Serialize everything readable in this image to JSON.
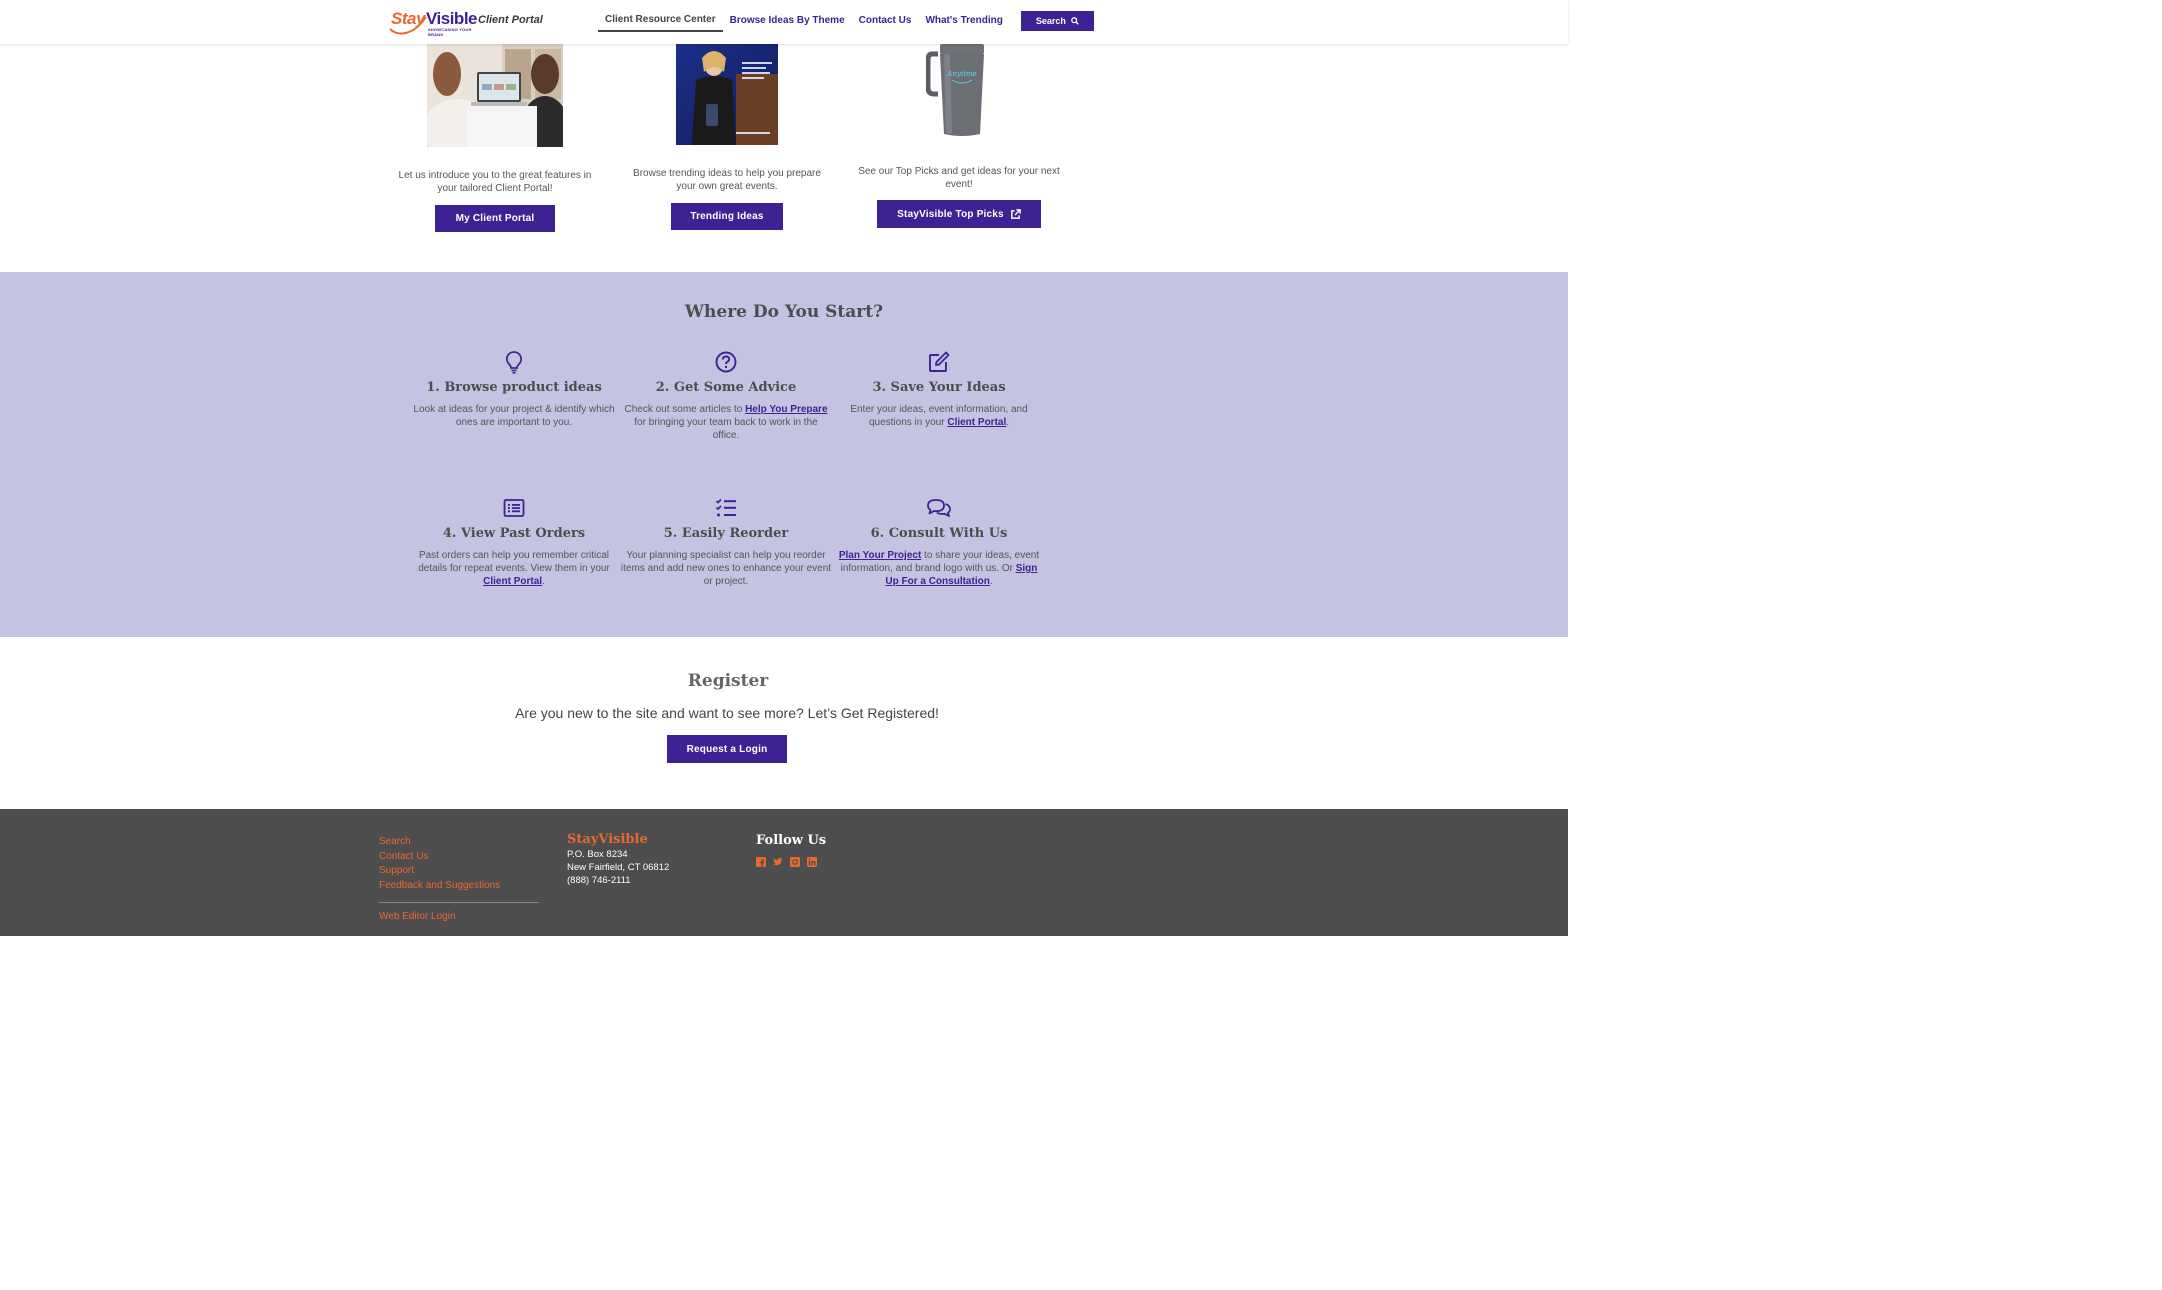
{
  "header": {
    "logo": {
      "stay": "Stay",
      "visible": "Visible",
      "tagline": "SHOWCASING YOUR BRAND",
      "portal": "Client Portal"
    },
    "nav": [
      {
        "label": "Client Resource Center",
        "active": true
      },
      {
        "label": "Browse Ideas By Theme"
      },
      {
        "label": "Contact Us"
      },
      {
        "label": "What's Trending"
      }
    ],
    "search_label": "Search"
  },
  "features": [
    {
      "image": "women-at-laptop-photo",
      "text": "Let us introduce you to the great features in your tailored Client Portal!",
      "button": "My Client Portal"
    },
    {
      "image": "trending-ideas-cover-photo",
      "text": "Browse trending ideas to help you prepare your own great events.",
      "button": "Trending Ideas"
    },
    {
      "image": "gray-tumbler-photo",
      "text": "See our Top Picks and get ideas for your next event!",
      "button": "StayVisible Top Picks"
    }
  ],
  "start": {
    "title": "Where Do You Start?",
    "steps": [
      {
        "icon": "lightbulb-icon",
        "title": "1. Browse product ideas",
        "text": "Look at ideas for your project & identify which ones are important to you."
      },
      {
        "icon": "question-circle-icon",
        "title": "2. Get Some Advice",
        "text_before": "Check out some articles to ",
        "link": "Help You Prepare",
        "text_after": " for bringing your team back to work in the office."
      },
      {
        "icon": "edit-icon",
        "title": "3. Save Your Ideas",
        "text_before": "Enter your ideas, event information, and questions in your ",
        "link": "Client Portal",
        "text_after": "."
      },
      {
        "icon": "list-alt-icon",
        "title": "4. View Past Orders",
        "text_before": "Past orders can help you remember critical details for repeat events. View them in your ",
        "link": "Client Portal",
        "text_after": "."
      },
      {
        "icon": "tasks-icon",
        "title": "5. Easily Reorder",
        "text": "Your planning specialist can help you reorder items and add new ones to enhance your event or project."
      },
      {
        "icon": "comments-icon",
        "title": "6. Consult With Us",
        "link1": "Plan Your Project",
        "text_mid": " to share your ideas, event information, and brand logo with us. Or ",
        "link2": "Sign Up For a Consultation",
        "text_after": "."
      }
    ]
  },
  "register": {
    "title": "Register",
    "text": "Are you new to the site and want to see more? Let’s Get Registered!",
    "button": "Request a Login"
  },
  "footer": {
    "links": [
      "Search",
      "Contact Us",
      "Support",
      "Feedback and Suggestions"
    ],
    "editor_login": "Web Editor Login",
    "company": "StayVisible",
    "address": [
      "P.O. Box 8234",
      "New Fairfield, CT 06812",
      "(888) 746-2111"
    ],
    "follow_title": "Follow Us",
    "socials": [
      "facebook-icon",
      "twitter-icon",
      "instagram-icon",
      "linkedin-icon"
    ]
  },
  "colors": {
    "brand_purple": "#3e2293",
    "brand_orange": "#e8692f",
    "section_bg": "#c4c3e1",
    "footer_bg": "#4d4d4d"
  }
}
